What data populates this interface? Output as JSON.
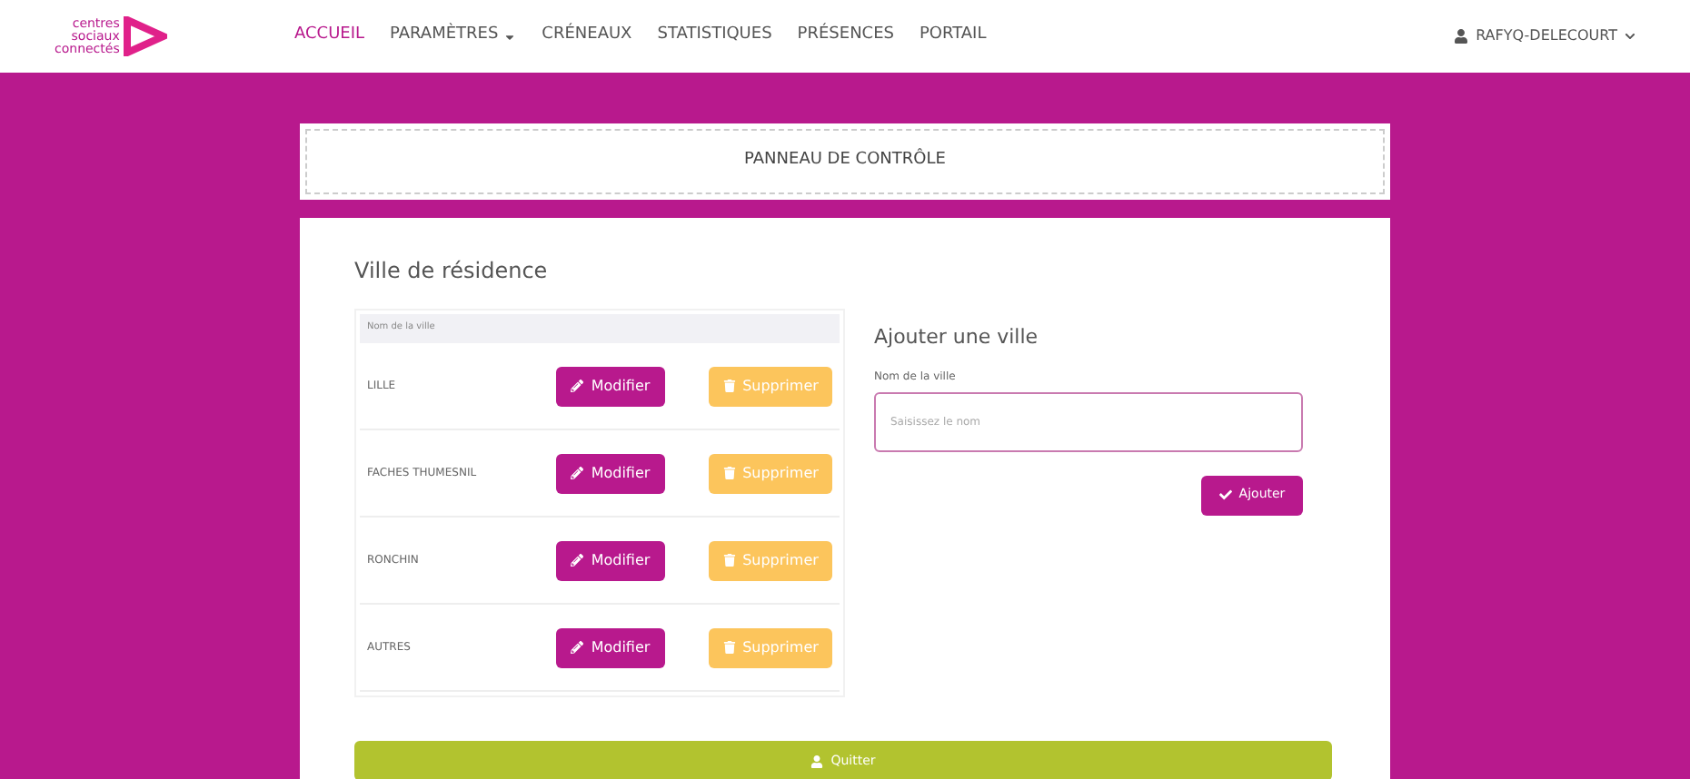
{
  "logo": {
    "lines": [
      "centres",
      "sociaux",
      "connectés"
    ]
  },
  "nav": [
    {
      "label": "ACCUEIL",
      "selected": true,
      "dropdown": false
    },
    {
      "label": "PARAMÈTRES",
      "selected": false,
      "dropdown": true
    },
    {
      "label": "CRÉNEAUX",
      "selected": false,
      "dropdown": false
    },
    {
      "label": "STATISTIQUES",
      "selected": false,
      "dropdown": false
    },
    {
      "label": "PRÉSENCES",
      "selected": false,
      "dropdown": false
    },
    {
      "label": "PORTAIL",
      "selected": false,
      "dropdown": false
    }
  ],
  "user": {
    "name": "RAFYQ-DELECOURT"
  },
  "panel_title": "PANNEAU DE CONTRÔLE",
  "section_title": "Ville de résidence",
  "table": {
    "columns": [
      "Nom de la ville"
    ],
    "rows": [
      {
        "name": "LILLE",
        "edit": "Modifier",
        "delete": "Supprimer"
      },
      {
        "name": "FACHES THUMESNIL",
        "edit": "Modifier",
        "delete": "Supprimer"
      },
      {
        "name": "RONCHIN",
        "edit": "Modifier",
        "delete": "Supprimer"
      },
      {
        "name": "AUTRES",
        "edit": "Modifier",
        "delete": "Supprimer"
      }
    ]
  },
  "add_form": {
    "title": "Ajouter une ville",
    "label": "Nom de la ville",
    "placeholder": "Saisissez le nom",
    "button": "Ajouter"
  },
  "quit_button": "Quitter"
}
